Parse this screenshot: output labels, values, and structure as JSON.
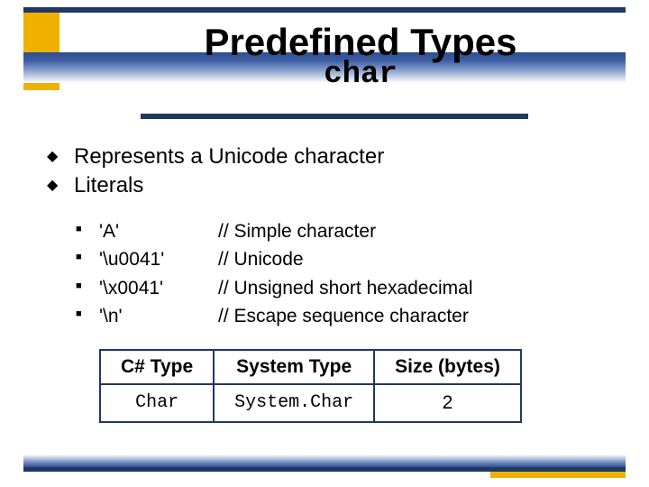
{
  "title": {
    "main": "Predefined Types",
    "sub": "char"
  },
  "bullets": [
    "Represents a Unicode character",
    "Literals"
  ],
  "literals": [
    {
      "code": "'A'",
      "comment": "// Simple character"
    },
    {
      "code": "'\\u0041'",
      "comment": "// Unicode"
    },
    {
      "code": "'\\x0041'",
      "comment": "// Unsigned short hexadecimal"
    },
    {
      "code": "'\\n'",
      "comment": "// Escape sequence character"
    }
  ],
  "table": {
    "headers": [
      "C# Type",
      "System Type",
      "Size (bytes)"
    ],
    "row": [
      "Char",
      "System.Char",
      "2"
    ]
  }
}
